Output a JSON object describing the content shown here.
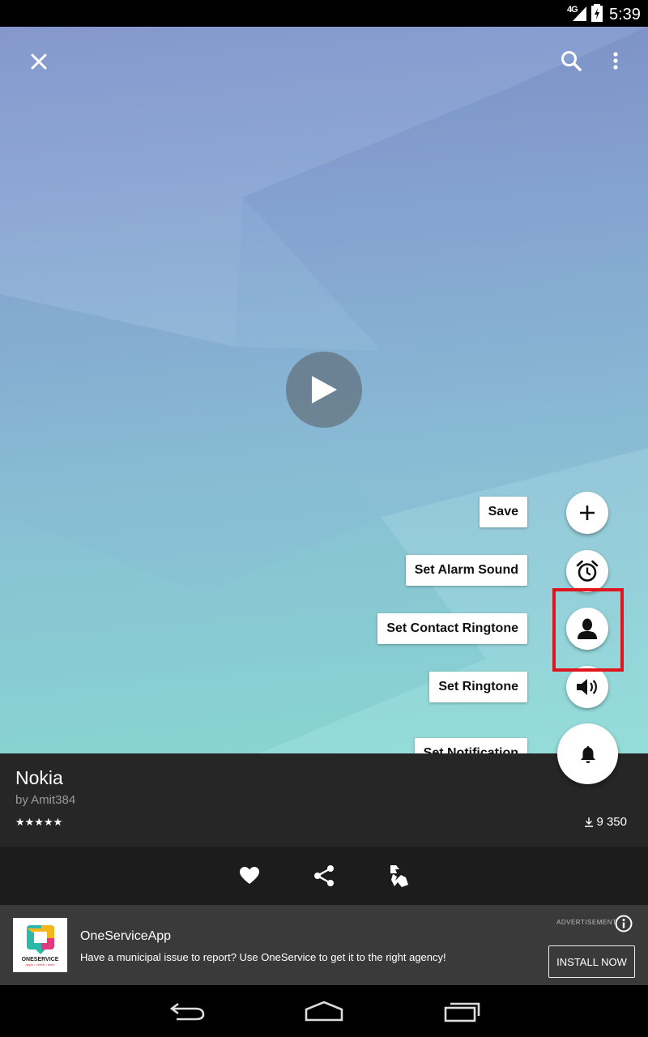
{
  "status_bar": {
    "network": "4G",
    "time": "5:39"
  },
  "toolbar": {
    "close_icon": "close-icon",
    "search_icon": "search-icon",
    "more_icon": "more-vert-icon"
  },
  "player": {
    "play_icon": "play-icon"
  },
  "fab_menu": {
    "items": [
      {
        "label": "Save",
        "icon": "plus-icon"
      },
      {
        "label": "Set Alarm Sound",
        "icon": "alarm-clock-icon"
      },
      {
        "label": "Set Contact Ringtone",
        "icon": "person-icon"
      },
      {
        "label": "Set Ringtone",
        "icon": "speaker-icon"
      },
      {
        "label": "Set Notification",
        "icon": "bell-icon"
      }
    ],
    "highlight_color": "#e0141c"
  },
  "ringtone": {
    "title": "Nokia",
    "author": "by Amit384",
    "rating_stars": "★★★★★",
    "rating": 5,
    "download_count": "9 350"
  },
  "actions": {
    "like_icon": "heart-icon",
    "share_icon": "share-icon",
    "dislike_icon": "thumbs-down-icon"
  },
  "ad": {
    "label": "ADVERTISEMENT",
    "app_name": "OneServiceApp",
    "logo_text": "ONESERVICE",
    "logo_tagline": "apply • check • send",
    "description": "Have a municipal issue to report? Use OneService to get it to the right agency!",
    "cta": "INSTALL NOW"
  },
  "nav_bar": {
    "back_icon": "back-icon",
    "home_icon": "home-icon",
    "recents_icon": "recents-icon"
  }
}
